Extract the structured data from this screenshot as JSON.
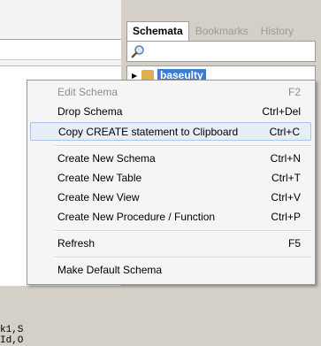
{
  "editor": {
    "code_line_1": "k1,S",
    "code_line_2": "Id,O"
  },
  "sidebar": {
    "tabs": [
      {
        "label": "Schemata",
        "active": true
      },
      {
        "label": "Bookmarks",
        "active": false
      },
      {
        "label": "History",
        "active": false
      }
    ],
    "search_placeholder": "",
    "selected_schema": "baseulty"
  },
  "context_menu": {
    "items": [
      {
        "label": "Edit Schema",
        "shortcut": "F2",
        "disabled": true
      },
      {
        "label": "Drop Schema",
        "shortcut": "Ctrl+Del"
      },
      {
        "label": "Copy CREATE statement to Clipboard",
        "shortcut": "Ctrl+C",
        "hover": true
      },
      {
        "label": "Create New Schema",
        "shortcut": "Ctrl+N"
      },
      {
        "label": "Create New Table",
        "shortcut": "Ctrl+T"
      },
      {
        "label": "Create New View",
        "shortcut": "Ctrl+V"
      },
      {
        "label": "Create New Procedure / Function",
        "shortcut": "Ctrl+P"
      },
      {
        "label": "Refresh",
        "shortcut": "F5"
      },
      {
        "label": "Make Default Schema",
        "shortcut": ""
      }
    ]
  }
}
